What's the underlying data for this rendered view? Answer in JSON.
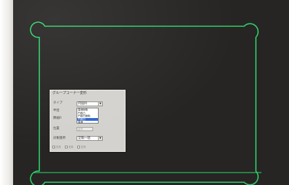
{
  "dialog": {
    "title": "グループコーナー変形",
    "type_label": "タイプ",
    "type_value": "円弧凹",
    "radius_label": "半径",
    "spacing_label": "隅幅R",
    "position_label": "位置",
    "position_value": "全内",
    "target_label": "対象箇所",
    "target_value": "全角一括",
    "type_options": [
      "直線面取",
      "円弧凸",
      "円弧凹面取",
      "円弧凹",
      "直線"
    ],
    "selected_option_index": 3,
    "checkboxes": [
      "左内",
      "右内",
      "左外"
    ]
  },
  "colors": {
    "screen_bg": "#262524",
    "outline": "#2fd36a",
    "selection": "#2f66d0"
  }
}
